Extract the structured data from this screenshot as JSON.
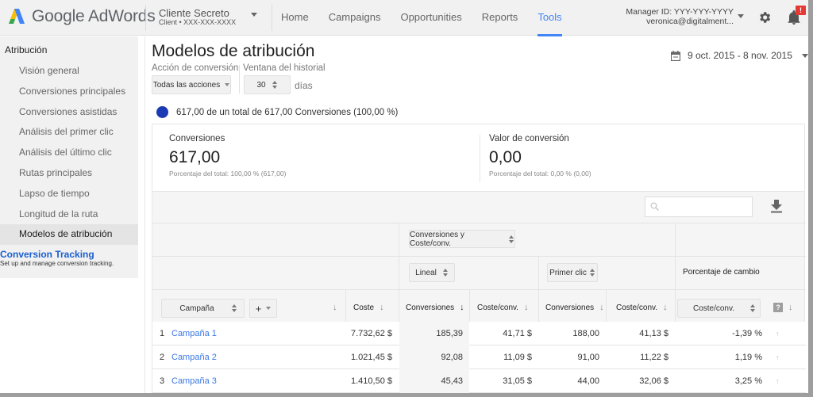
{
  "app": {
    "name": "Google AdWords"
  },
  "client": {
    "name": "Cliente Secreto",
    "id": "Client • XXX-XXX-XXXX"
  },
  "nav": {
    "items": [
      {
        "label": "Home",
        "active": false
      },
      {
        "label": "Campaigns",
        "active": false
      },
      {
        "label": "Opportunities",
        "active": false
      },
      {
        "label": "Reports",
        "active": false
      },
      {
        "label": "Tools",
        "active": true
      }
    ]
  },
  "account": {
    "manager_id": "Manager ID: YYY-YYY-YYYY",
    "email": "veronica@digitalment...",
    "notification_badge": "!"
  },
  "sidebar": {
    "heading": "Atribución",
    "items": [
      {
        "label": "Visión general"
      },
      {
        "label": "Conversiones principales"
      },
      {
        "label": "Conversiones asistidas"
      },
      {
        "label": "Análisis del primer clic"
      },
      {
        "label": "Análisis del último clic"
      },
      {
        "label": "Rutas principales"
      },
      {
        "label": "Lapso de tiempo"
      },
      {
        "label": "Longitud de la ruta"
      },
      {
        "label": "Modelos de atribución",
        "active": true
      }
    ],
    "tracking": {
      "title": "Conversion Tracking",
      "subtitle": "Set up and manage conversion tracking."
    }
  },
  "page": {
    "title": "Modelos de atribución",
    "date_range": "9 oct. 2015 - 8 nov. 2015",
    "filters": {
      "action_label": "Acción de conversión",
      "action_value": "Todas las acciones",
      "window_label": "Ventana del historial",
      "window_value": "30",
      "window_unit": "días"
    },
    "legend": "617,00 de un total de 617,00 Conversiones (100,00 %)",
    "legend_color": "#1a3bb3"
  },
  "metrics": [
    {
      "label": "Conversiones",
      "value": "617,00",
      "sub": "Porcentaje del total: 100,00 % (617,00)"
    },
    {
      "label": "Valor de conversión",
      "value": "0,00",
      "sub": "Porcentaje del total: 0,00 % (0,00)"
    }
  ],
  "table": {
    "metric_selector": "Conversiones y Coste/conv.",
    "model_a": "Lineal",
    "model_b": "Primer clic",
    "change_heading": "Porcentaje de cambio",
    "segment_selector": "Campaña",
    "add_button": "+",
    "change_selector": "Coste/conv.",
    "help": "?",
    "columns": {
      "cost": "Coste",
      "conv_a": "Conversiones",
      "cpa_a": "Coste/conv.",
      "conv_b": "Conversiones",
      "cpa_b": "Coste/conv."
    },
    "rows": [
      {
        "index": "1",
        "campaign": "Campaña 1",
        "cost": "7.732,62 $",
        "conv_a": "185,39",
        "cpa_a": "41,71 $",
        "conv_b": "188,00",
        "cpa_b": "41,13 $",
        "change": "-1,39 %"
      },
      {
        "index": "2",
        "campaign": "Campaña 2",
        "cost": "1.021,45 $",
        "conv_a": "92,08",
        "cpa_a": "11,09 $",
        "conv_b": "91,00",
        "cpa_b": "11,22 $",
        "change": "1,19 %"
      },
      {
        "index": "3",
        "campaign": "Campaña 3",
        "cost": "1.410,50 $",
        "conv_a": "45,43",
        "cpa_a": "31,05 $",
        "conv_b": "44,00",
        "cpa_b": "32,06 $",
        "change": "3,25 %"
      }
    ]
  }
}
